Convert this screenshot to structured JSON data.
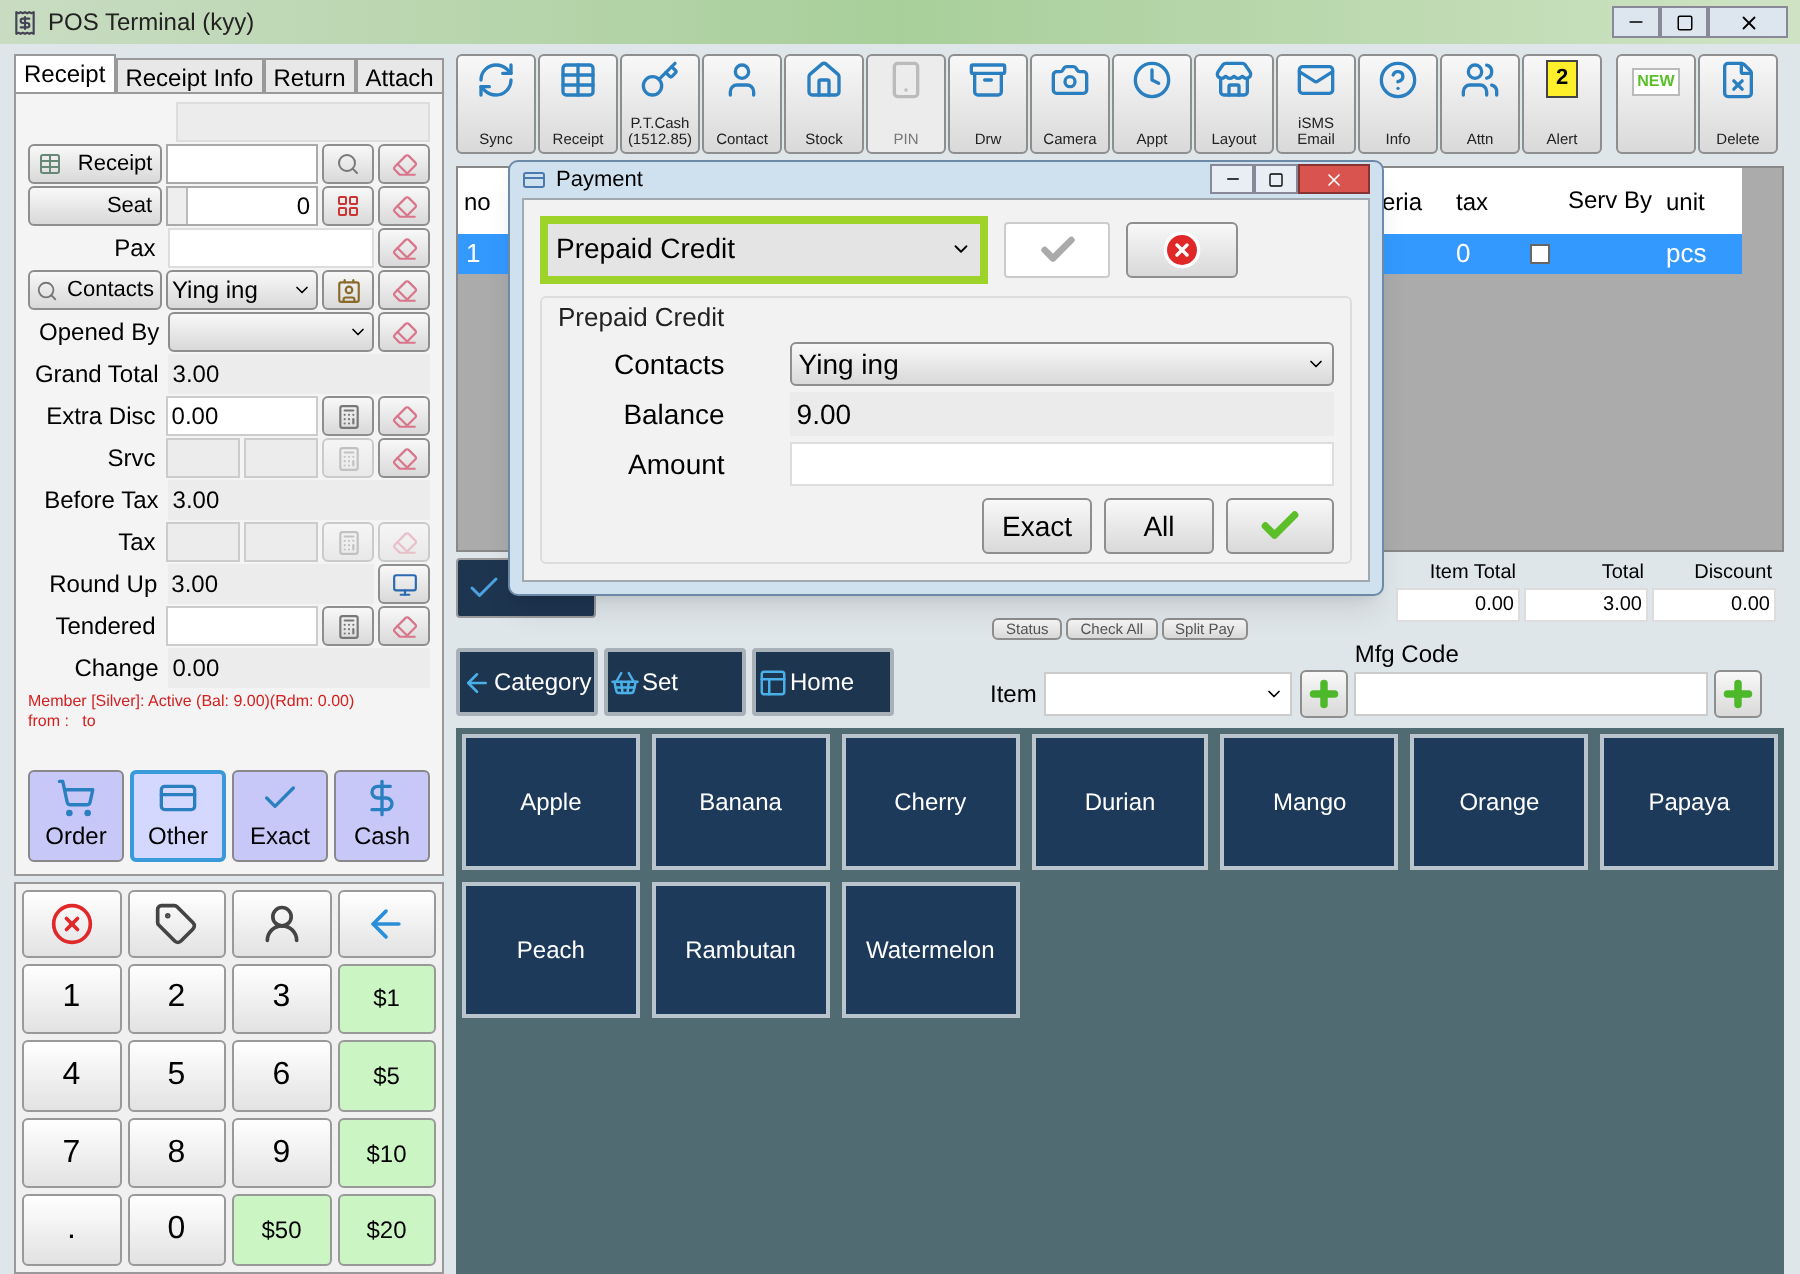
{
  "window": {
    "title": "POS Terminal (kyy)"
  },
  "tabs": [
    {
      "label": "Receipt",
      "selected": true
    },
    {
      "label": "Receipt Info",
      "selected": false
    },
    {
      "label": "Return",
      "selected": false
    },
    {
      "label": "Attach",
      "selected": false
    }
  ],
  "receipt_form": {
    "receipt_button": "Receipt",
    "seat_button": "Seat",
    "seat_value": "0",
    "pax_label": "Pax",
    "contacts_button": "Contacts",
    "contact_value": "Ying ing",
    "opened_by_label": "Opened By"
  },
  "summary_rows": [
    {
      "label": "Grand Total",
      "value": "3.00",
      "kind": "readonly"
    },
    {
      "label": "Extra Disc",
      "value": "0.00",
      "kind": "input"
    },
    {
      "label": "Srvc",
      "kind": "split",
      "eraser_enabled": true
    },
    {
      "label": "Before Tax",
      "value": "3.00",
      "kind": "readonly"
    },
    {
      "label": "Tax",
      "kind": "split",
      "eraser_enabled": false
    },
    {
      "label": "Round Up",
      "value": "3.00",
      "kind": "display"
    },
    {
      "label": "Tendered",
      "kind": "input"
    },
    {
      "label": "Change",
      "value": "0.00",
      "kind": "readonly"
    }
  ],
  "member_note": [
    "Member [Silver]: Active (Bal: 9.00)(Rdm: 0.00)",
    "from :   to"
  ],
  "pay_buttons": [
    {
      "label": "Order",
      "selected": false
    },
    {
      "label": "Other",
      "selected": true
    },
    {
      "label": "Exact",
      "selected": false
    },
    {
      "label": "Cash",
      "selected": false
    }
  ],
  "keypad": [
    {
      "kind": "cancel"
    },
    {
      "kind": "tag"
    },
    {
      "kind": "user"
    },
    {
      "kind": "back"
    },
    {
      "label": "1",
      "kind": "digit"
    },
    {
      "label": "2",
      "kind": "digit"
    },
    {
      "label": "3",
      "kind": "digit"
    },
    {
      "label": "$1",
      "kind": "cash"
    },
    {
      "label": "4",
      "kind": "digit"
    },
    {
      "label": "5",
      "kind": "digit"
    },
    {
      "label": "6",
      "kind": "digit"
    },
    {
      "label": "$5",
      "kind": "cash"
    },
    {
      "label": "7",
      "kind": "digit"
    },
    {
      "label": "8",
      "kind": "digit"
    },
    {
      "label": "9",
      "kind": "digit"
    },
    {
      "label": "$10",
      "kind": "cash"
    },
    {
      "label": ".",
      "kind": "digit"
    },
    {
      "label": "0",
      "kind": "digit"
    },
    {
      "label": "$50",
      "kind": "cash"
    },
    {
      "label": "$20",
      "kind": "cash"
    }
  ],
  "toolbar": [
    {
      "label": "Sync",
      "disabled": false
    },
    {
      "label": "Receipt",
      "disabled": false
    },
    {
      "label": "P.T.Cash (1512.85)",
      "disabled": false
    },
    {
      "label": "Contact",
      "disabled": false
    },
    {
      "label": "Stock",
      "disabled": false
    },
    {
      "label": "PIN",
      "disabled": true
    },
    {
      "label": "Drw",
      "disabled": false
    },
    {
      "label": "Camera",
      "disabled": false
    },
    {
      "label": "Appt",
      "disabled": false
    },
    {
      "label": "Layout",
      "disabled": false
    },
    {
      "label": "iSMS Email",
      "disabled": false
    },
    {
      "label": "Info",
      "disabled": false
    },
    {
      "label": "Attn",
      "disabled": false
    },
    {
      "label": "Alert",
      "badge": "2",
      "disabled": false
    },
    {
      "icon_text": "NEW",
      "disabled": false
    },
    {
      "label": "Delete",
      "disabled": false
    }
  ],
  "order_table": {
    "columns": [
      "no",
      "eria",
      "tax",
      "Serv By",
      "unit"
    ],
    "rows": [
      {
        "no": "1",
        "tax": "0",
        "checked": false,
        "unit": "pcs",
        "selected": true
      }
    ]
  },
  "totals": {
    "columns": [
      "Item Total",
      "Total",
      "Discount"
    ],
    "values": [
      "0.00",
      "3.00",
      "0.00"
    ]
  },
  "order_actions": [
    "Status",
    "Check All",
    "Split Pay"
  ],
  "nav_buttons": [
    "Category",
    "Set",
    "Home"
  ],
  "item_label": "Item",
  "mfg_code_label": "Mfg Code",
  "products": [
    "Apple",
    "Banana",
    "Cherry",
    "Durian",
    "Mango",
    "Orange",
    "Papaya",
    "Peach",
    "Rambutan",
    "Watermelon"
  ],
  "payment_dialog": {
    "title": "Payment",
    "method": "Prepaid Credit",
    "group_title": "Prepaid Credit",
    "contacts_label": "Contacts",
    "contact_value": "Ying ing",
    "balance_label": "Balance",
    "balance_value": "9.00",
    "amount_label": "Amount",
    "buttons": [
      "Exact",
      "All"
    ]
  }
}
